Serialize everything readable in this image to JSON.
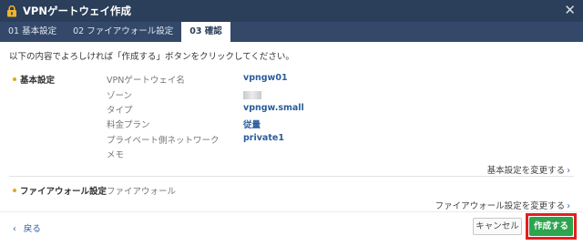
{
  "window": {
    "title": "VPNゲートウェイ作成",
    "icon": "vpn-gateway-icon",
    "close_label": "✕"
  },
  "tabs": [
    {
      "label": "01 基本設定",
      "active": false
    },
    {
      "label": "02 ファイアウォール設定",
      "active": false
    },
    {
      "label": "03 確認",
      "active": true
    }
  ],
  "instruction": "以下の内容でよろしければ「作成する」ボタンをクリックしてください。",
  "basic": {
    "section_label": "基本設定",
    "rows": [
      {
        "key": "VPNゲートウェイ名",
        "value": "vpngw01"
      },
      {
        "key": "ゾーン",
        "value": ""
      },
      {
        "key": "タイプ",
        "value": "vpngw.small"
      },
      {
        "key": "料金プラン",
        "value": "従量"
      },
      {
        "key": "プライベート側ネットワーク",
        "value": "private1"
      },
      {
        "key": "メモ",
        "value": ""
      }
    ],
    "change_link": "基本設定を変更する",
    "chevron": "›"
  },
  "firewall": {
    "section_label": "ファイアウォール設定",
    "key": "ファイアウォール",
    "change_link": "ファイアウォール設定を変更する",
    "chevron": "›"
  },
  "footer": {
    "back_chevron": "‹",
    "back_label": "戻る",
    "cancel_label": "キャンセル",
    "create_label": "作成する"
  },
  "colors": {
    "title_bar": "#2b3e5a",
    "tab_bar": "#34496a",
    "accent_dot": "#e8a317",
    "link_blue": "#2a5d9c",
    "create_button": "#2da44e",
    "highlight": "#e02020"
  }
}
